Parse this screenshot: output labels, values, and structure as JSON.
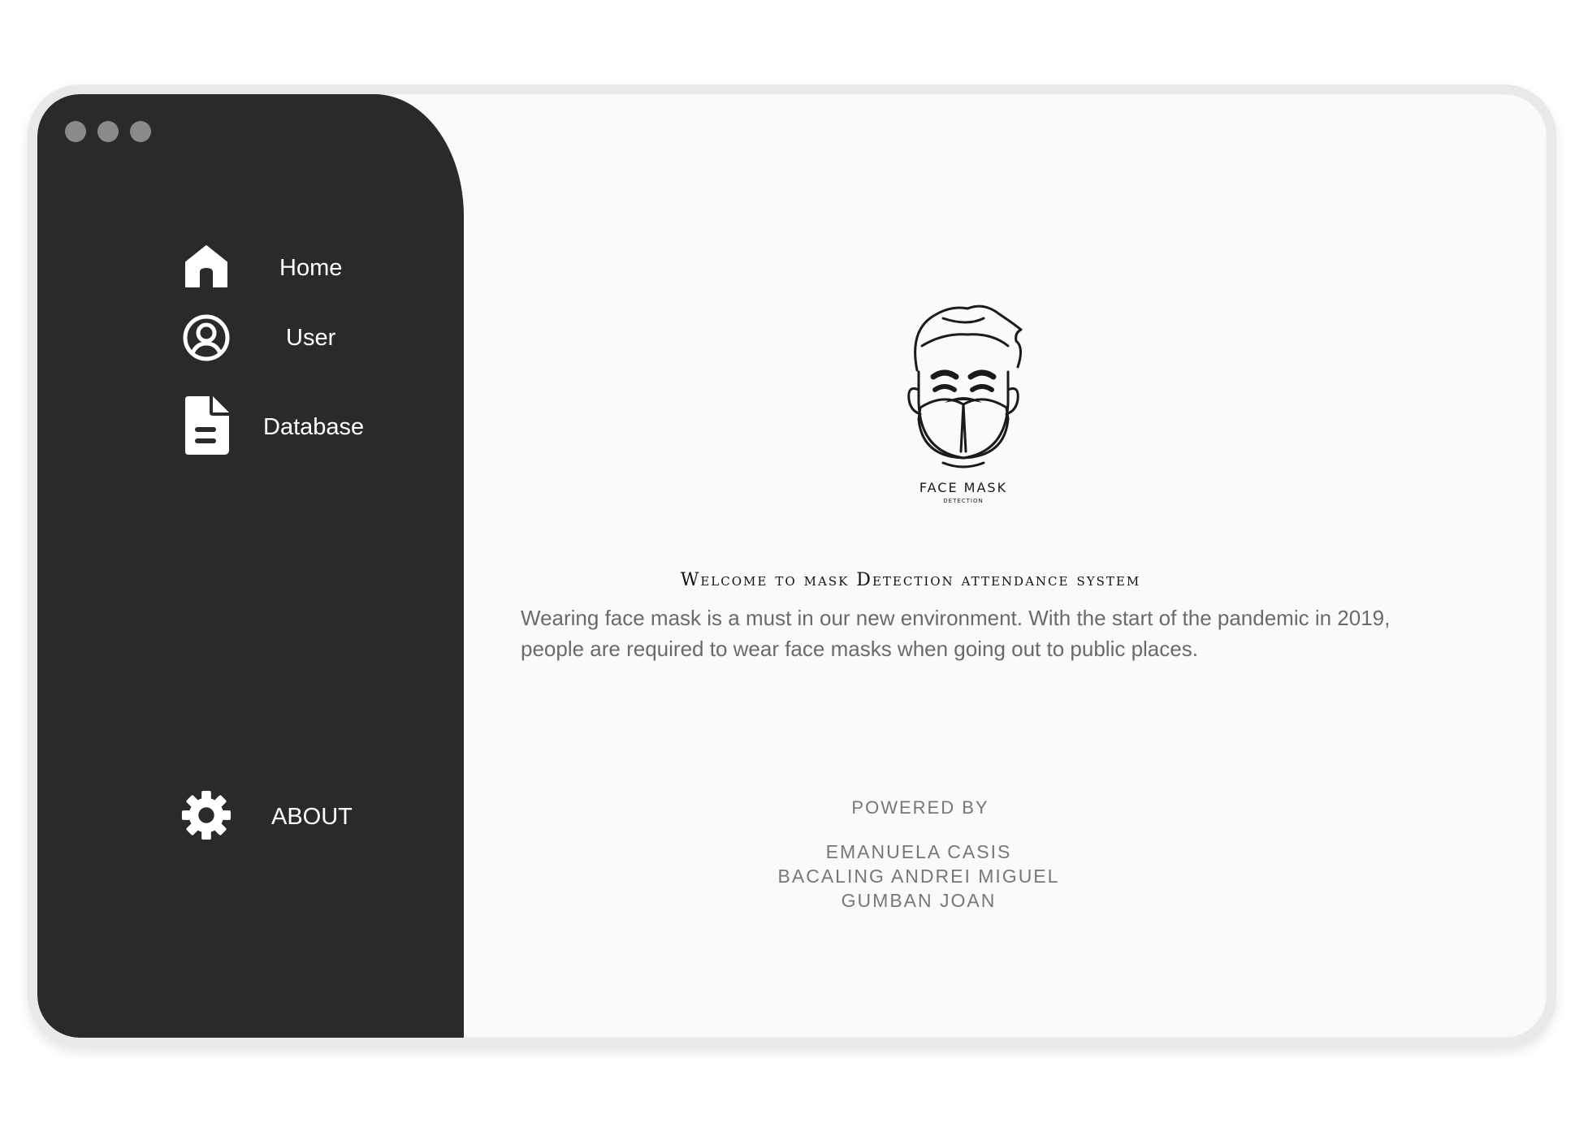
{
  "window": {
    "controls": [
      "close",
      "minimize",
      "maximize"
    ]
  },
  "sidebar": {
    "items": [
      {
        "label": "Home",
        "icon": "home-icon"
      },
      {
        "label": "User",
        "icon": "user-circle-icon"
      },
      {
        "label": "Database",
        "icon": "document-icon"
      }
    ],
    "about": {
      "label": "ABOUT",
      "icon": "gear-icon"
    }
  },
  "main": {
    "logo": {
      "title": "FACE MASK",
      "subtitle": "DETECTION"
    },
    "welcome": "Welcome to mask Detection attendance system",
    "description": "Wearing face mask is a must in our  new environment. With the start of the pandemic in 2019, people  are required to wear face masks when going out to public places.",
    "powered_by": "POWERED BY",
    "credits": [
      "EMANUELA CASIS",
      "BACALING ANDREI MIGUEL",
      "GUMBAN JOAN"
    ]
  },
  "colors": {
    "sidebar": "#2a2a2a",
    "content": "#fafafa",
    "text_muted": "#6a6a6a"
  }
}
